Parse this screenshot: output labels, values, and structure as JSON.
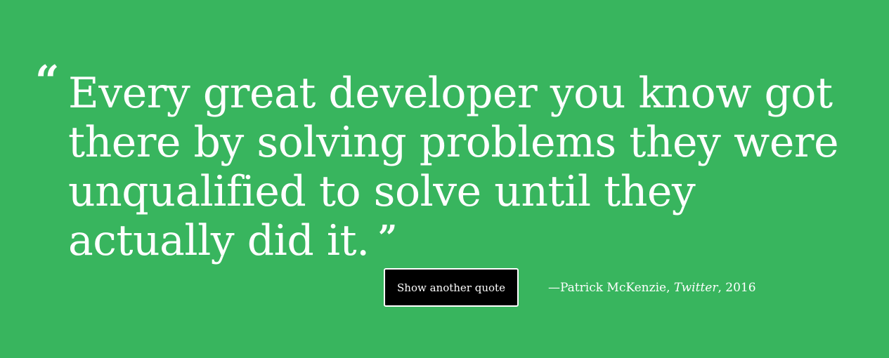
{
  "colors": {
    "background": "#38b55e",
    "text": "#ffffff",
    "button_background": "#000000",
    "button_border": "#ffffff"
  },
  "quote": {
    "open_mark": "“",
    "text": "Every great developer you know got there by solving problems they were unqualified to solve until they actually did it.",
    "close_mark": "”"
  },
  "button": {
    "label": "Show another quote"
  },
  "attribution": {
    "author": "—Patrick McKenzie,",
    "source": "Twitter",
    "year": ", 2016"
  }
}
